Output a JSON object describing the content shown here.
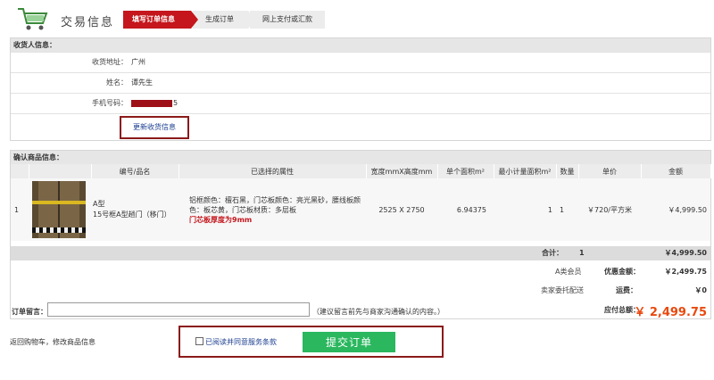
{
  "header": {
    "title": "交易信息",
    "steps": [
      {
        "label": "填写订单信息",
        "active": true
      },
      {
        "label": "生成订单",
        "active": false
      },
      {
        "label": "网上支付或汇款",
        "active": false
      }
    ]
  },
  "receiver": {
    "section_title": "收货人信息：",
    "address_label": "收货地址：",
    "address_value": "广州",
    "name_label": "姓名：",
    "name_value": "谭先生",
    "phone_label": "手机号码：",
    "phone_tail": "5",
    "update_link": "更新收货信息"
  },
  "goods": {
    "section_title": "确认商品信息：",
    "columns": [
      "编号/品名",
      "已选择的属性",
      "宽度mmX高度mm",
      "单个面积m²",
      "最小计量面积m²",
      "数量",
      "单价",
      "金额"
    ],
    "items": [
      {
        "index": "1",
        "code": "A型",
        "name": "15号框A型趟门（移门）",
        "attrs": "铝框颜色：檀石黑，门芯板颜色：亮光黑砂，腰线板颜色：板芯黄，门芯板材质：多层板",
        "attr_note": "门芯板厚度为9mm",
        "size": "2525 X 2750",
        "area": "6.94375",
        "min_area": "1",
        "qty": "1",
        "unit_price": "￥720/平方米",
        "amount": "￥4,999.50"
      }
    ],
    "total_label": "合计：",
    "total_qty": "1",
    "total_amount": "￥4,999.50"
  },
  "summary": {
    "member_type": "A类会员",
    "discount_label": "优惠金额：",
    "discount_value": "￥2,499.75",
    "delivery": "卖家委托配送",
    "shipping_label": "运费：",
    "shipping_value": "￥0",
    "payable_label": "应付总额：",
    "payable_value": "￥ 2,499.75"
  },
  "message": {
    "label": "订单留言：",
    "value": "",
    "hint": "（建议留言前先与商家沟通确认的内容。）"
  },
  "footer": {
    "return_link": "返回购物车，修改商品信息",
    "agree_label": "已阅读并同意服务条款",
    "submit_label": "提交订单",
    "submit_color": "#2ab75e",
    "accent": "#c4161c"
  }
}
